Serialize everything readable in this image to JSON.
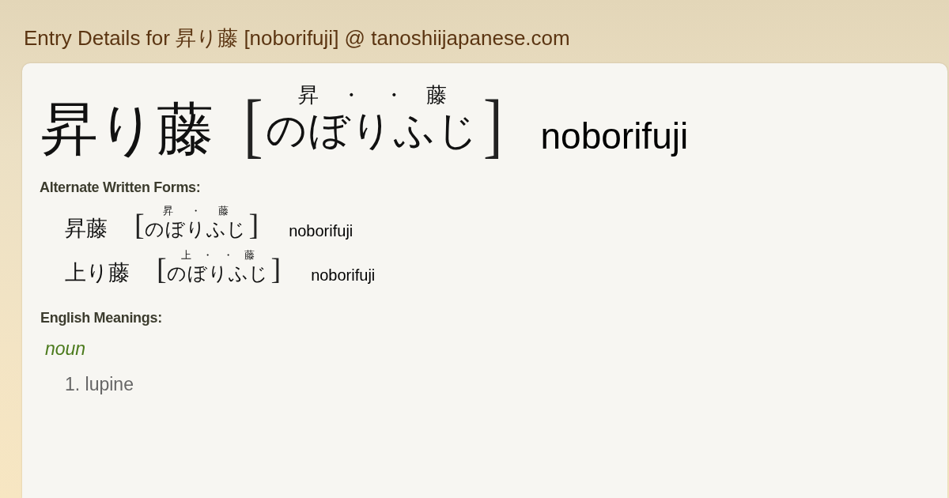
{
  "page_title": "Entry Details for 昇り藤 [noborifuji] @ tanoshiijapanese.com",
  "entry": {
    "kanji": "昇り藤",
    "open_bracket": "[",
    "furigana": [
      "昇",
      "・",
      "・",
      "藤"
    ],
    "kana": "のぼりふじ",
    "close_bracket": "]",
    "romaji": "noborifuji"
  },
  "alternate_forms": {
    "heading": "Alternate Written Forms:",
    "forms": [
      {
        "kanji": "昇藤",
        "open_bracket": "[",
        "furigana": [
          "昇",
          "・",
          "藤"
        ],
        "kana": "のぼりふじ",
        "close_bracket": "]",
        "romaji": "noborifuji"
      },
      {
        "kanji": "上り藤",
        "open_bracket": "[",
        "furigana": [
          "上",
          "・",
          "・",
          "藤"
        ],
        "kana": "のぼりふじ",
        "close_bracket": "]",
        "romaji": "noborifuji"
      }
    ]
  },
  "meanings": {
    "heading": "English Meanings:",
    "part_of_speech": "noun",
    "senses": [
      {
        "number": "1.",
        "text": "lupine"
      }
    ]
  }
}
